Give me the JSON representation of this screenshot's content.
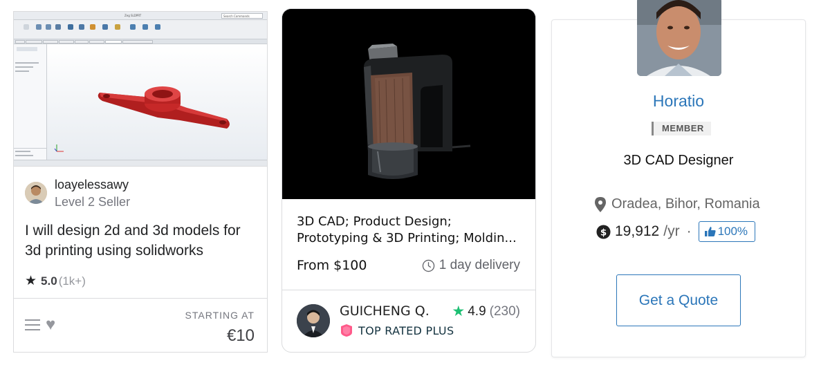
{
  "card1": {
    "thumbnail_window_title": "Zeg SLDPRT",
    "thumbnail_search": "Search Commands",
    "seller_name": "loayelessawy",
    "seller_level": "Level 2 Seller",
    "gig_title": "I will design 2d and 3d models for 3d printing using solidworks",
    "rating": "5.0",
    "rating_count": "(1k+)",
    "starting_at_label": "STARTING AT",
    "price": "€10",
    "icons": [
      "star-icon",
      "menu-icon",
      "heart-icon"
    ]
  },
  "card2": {
    "title_line1": "3D CAD; Product Design;",
    "title_line2": "Prototyping & 3D Printing; Moldin...",
    "price": "From $100",
    "delivery": "1 day delivery",
    "seller_name": "GUICHENG Q.",
    "rating": "4.9",
    "rating_count": "(230)",
    "badge": "TOP RATED PLUS",
    "colors": {
      "star": "#1dbf73",
      "badge": "#ff5a8a"
    },
    "icons": [
      "clock-icon",
      "star-icon",
      "top-rated-badge-icon"
    ]
  },
  "card3": {
    "name": "Horatio",
    "member_label": "MEMBER",
    "title": "3D CAD Designer",
    "location": "Oradea, Bihor, Romania",
    "earnings": "19,912",
    "earnings_unit": "/yr",
    "separator": "·",
    "job_success": "100%",
    "quote_button": "Get a Quote",
    "colors": {
      "accent": "#2b76b9"
    },
    "icons": [
      "location-pin-icon",
      "dollar-icon",
      "thumbs-up-icon"
    ]
  }
}
